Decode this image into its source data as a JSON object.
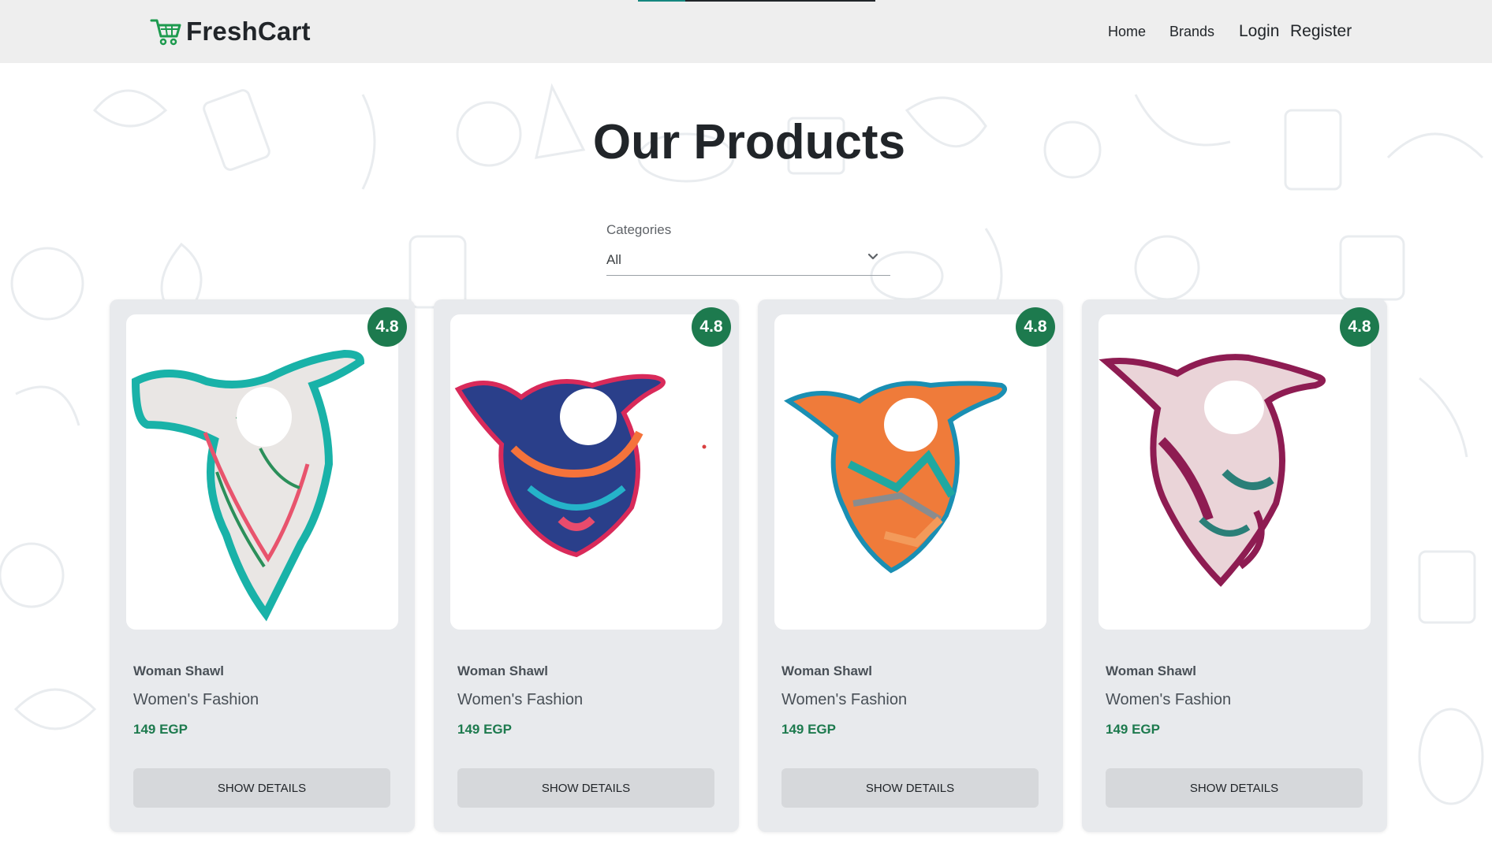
{
  "navbar": {
    "brand": "FreshCart",
    "links": [
      "Home",
      "Brands"
    ],
    "auth": [
      "Login",
      "Register"
    ]
  },
  "page": {
    "title": "Our Products"
  },
  "filter": {
    "label": "Categories",
    "value": "All"
  },
  "products": [
    {
      "name": "Woman Shawl",
      "category": "Women's Fashion",
      "price": "149 EGP",
      "rating": "4.8",
      "button": "SHOW DETAILS"
    },
    {
      "name": "Woman Shawl",
      "category": "Women's Fashion",
      "price": "149 EGP",
      "rating": "4.8",
      "button": "SHOW DETAILS"
    },
    {
      "name": "Woman Shawl",
      "category": "Women's Fashion",
      "price": "149 EGP",
      "rating": "4.8",
      "button": "SHOW DETAILS"
    },
    {
      "name": "Woman Shawl",
      "category": "Women's Fashion",
      "price": "149 EGP",
      "rating": "4.8",
      "button": "SHOW DETAILS"
    }
  ],
  "colors": {
    "accent": "#1d7a4e",
    "navbar_bg": "#eeeeee",
    "card_bg": "#e8eaed",
    "button_bg": "#d6d8db"
  }
}
